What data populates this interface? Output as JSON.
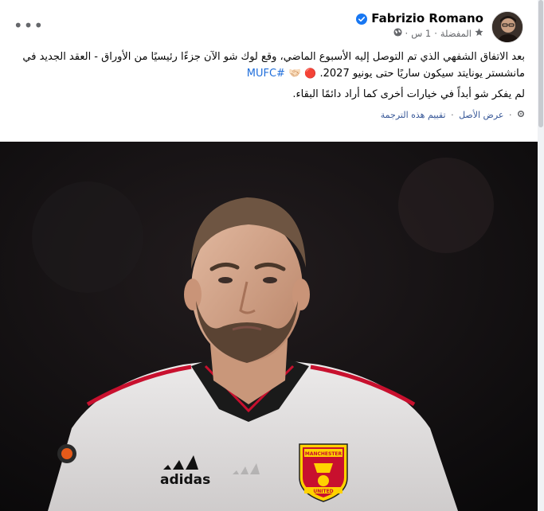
{
  "post": {
    "author": "Fabrizio Romano",
    "time": "1 س",
    "favorites_label": "المفضلة",
    "dot": "·",
    "more_label": "•••",
    "paragraph_1": "بعد الاتفاق الشفهي الذي تم التوصل إليه الأسبوع الماضي، وقع لوك شو الآن جزءًا رئيسيًا من الأوراق - العقد الجديد في مانشستر يونايتد سيكون ساريًا حتى يونيو 2027.",
    "emoji_dot": "🔴",
    "emoji_hand": "🤝🏻",
    "hashtag": "#MUFC",
    "paragraph_2": "لم يفكر شو أبداً في خيارات أخرى كما أراد دائمًا البقاء.",
    "translation": {
      "view_original": "عرض الأصل",
      "rate_translation": "تقييم هذه الترجمة",
      "separator": "·"
    },
    "photo": {
      "sponsor": "adidas",
      "crest_top": "MANCHESTER",
      "crest_bottom": "UNITED"
    }
  },
  "colors": {
    "link": "#385898",
    "hashtag": "#216fdb",
    "verified": "#1877f2",
    "meta": "#65676b"
  }
}
